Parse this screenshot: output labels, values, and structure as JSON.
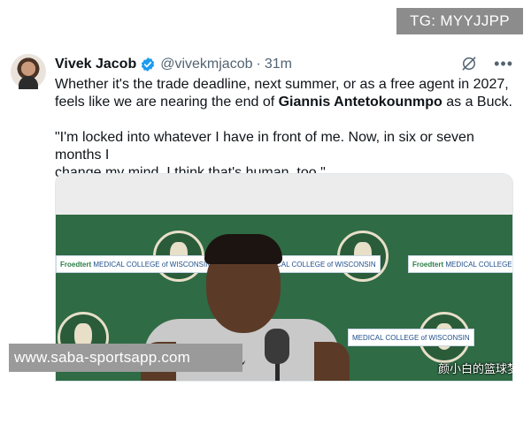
{
  "watermark_tag": "TG: MYYJJPP",
  "tweet": {
    "author_name": "Vivek Jacob",
    "handle": "@vivekmjacob",
    "separator": "·",
    "time": "31m",
    "line1": "Whether it's the trade deadline, next summer, or as a free agent in 2027,",
    "line2_pre": "feels like we are nearing the end of ",
    "line2_bold": "Giannis Antetokounmpo",
    "line2_post": " as a Buck.",
    "quote_line1": "\"I'm locked into whatever I have in front of me. Now, in six or seven months I",
    "quote_line2": "change my mind, I think that's human, too.\""
  },
  "media": {
    "sponsor_text": "Froedtert & Medical College of Wisconsin",
    "sponsor_a": "Froedtert",
    "sponsor_b": "MEDICAL COLLEGE of WISCONSIN",
    "overlay_watermark": "颜小白的篮球梦"
  },
  "site_watermark": "www.saba-sportsapp.com",
  "icons": {
    "verified": "verified-badge-icon",
    "grok": "grok-icon",
    "more": "more-icon"
  },
  "colors": {
    "verified_blue": "#1d9bf0",
    "muted_text": "#536471",
    "backdrop_green": "#2f6b44"
  }
}
